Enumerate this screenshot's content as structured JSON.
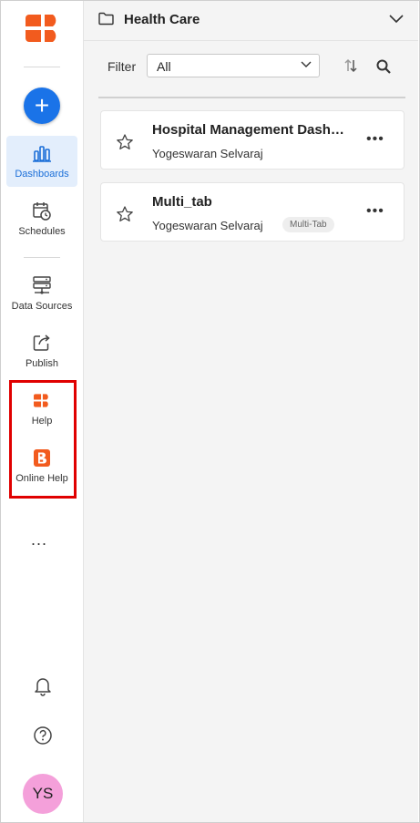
{
  "sidebar": {
    "nav": [
      {
        "label": "Dashboards",
        "icon": "bar-chart-icon",
        "active": true
      },
      {
        "label": "Schedules",
        "icon": "calendar-clock-icon",
        "active": false
      },
      {
        "label": "Data Sources",
        "icon": "server-icon",
        "active": false
      },
      {
        "label": "Publish",
        "icon": "share-out-icon",
        "active": false
      },
      {
        "label": "Help",
        "icon": "help-logo-icon",
        "active": false
      },
      {
        "label": "Online Help",
        "icon": "boldbi-icon",
        "active": false
      }
    ],
    "add_label": "+",
    "more_label": "...",
    "avatar_initials": "YS"
  },
  "header": {
    "title": "Health Care"
  },
  "filter": {
    "label": "Filter",
    "selected": "All"
  },
  "items": [
    {
      "title": "Hospital Management Dashboard",
      "author": "Yogeswaran Selvaraj",
      "tag": ""
    },
    {
      "title": "Multi_tab",
      "author": "Yogeswaran Selvaraj",
      "tag": "Multi-Tab"
    }
  ],
  "colors": {
    "accent": "#1a73e8",
    "brand_orange": "#f25b1e",
    "highlight_box": "#e00000",
    "avatar": "#f4a0da"
  }
}
